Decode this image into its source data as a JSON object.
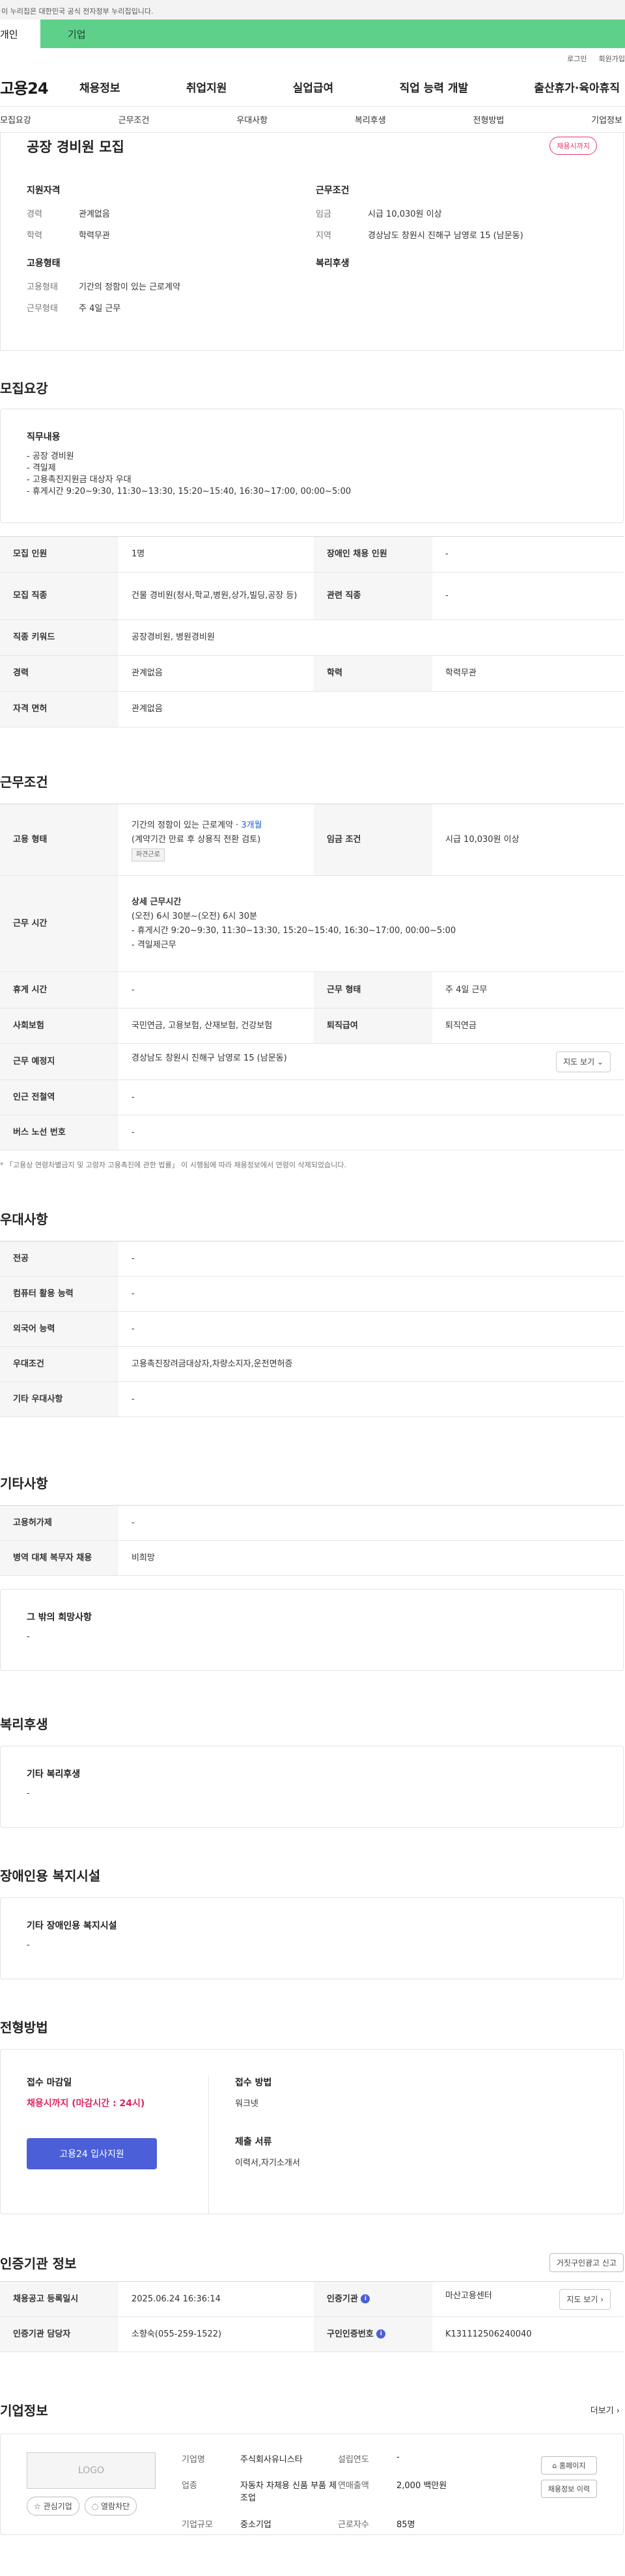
{
  "banner": {
    "text": "이 누리집은 대한민국 공식 전자정부 누리집입니다."
  },
  "user_tabs": {
    "personal": "개인",
    "company": "기업"
  },
  "util_links": [
    "로그인",
    "회원가입"
  ],
  "logo": "고용24",
  "gnb": [
    "채용정보",
    "취업지원",
    "실업급여",
    "직업 능력 개발",
    "출산휴가·육아휴직"
  ],
  "anchor_nav": [
    "모집요강",
    "근무조건",
    "우대사항",
    "복리후생",
    "전형방법",
    "기업정보"
  ],
  "summary": {
    "title": "공장 경비원 모집",
    "badge": "채용시까지",
    "qualification_title": "지원자격",
    "career_label": "경력",
    "career_value": "관계없음",
    "education_label": "학력",
    "education_value": "학력무관",
    "employment_title": "고용형태",
    "emp_type_label": "고용형태",
    "emp_type_value": "기간의 정함이 있는 근로계약",
    "work_form_label": "근무형태",
    "work_form_value": "주 4일 근무",
    "conditions_title": "근무조건",
    "wage_label": "임금",
    "wage_value": "시급 10,030원 이상",
    "region_label": "지역",
    "region_value": "경상남도 창원시 진해구 남영로 15 (남문동)",
    "welfare_title": "복리후생"
  },
  "recruit": {
    "section_title": "모집요강",
    "duty_title": "직무내용",
    "duty_lines": [
      "- 공장 경비원",
      "- 격일제",
      "- 고용촉진지원금 대상자 우대",
      "- 휴게시간 9:20~9:30, 11:30~13:30, 15:20~15:40, 16:30~17:00, 00:00~5:00"
    ],
    "rows": {
      "headcount_h": "모집 인원",
      "headcount_v": "1명",
      "disabled_h": "장애인 채용 인원",
      "disabled_v": "-",
      "job_h": "모집 직종",
      "job_v": "건물 경비원(청사,학교,병원,상가,빌딩,공장 등)",
      "related_h": "관련 직종",
      "related_v": "-",
      "keyword_h": "직종 키워드",
      "keyword_v": "공장경비원, 병원경비원",
      "career_h": "경력",
      "career_v": "관계없음",
      "edu_h": "학력",
      "edu_v": "학력무관",
      "license_h": "자격 면허",
      "license_v": "관계없음"
    }
  },
  "conditions": {
    "section_title": "근무조건",
    "emp_h": "고용 형태",
    "emp_v1": "기간의 정함이 있는 근로계약 · ",
    "emp_v1_period": "3개월",
    "emp_v2": "(계약기간 만료 후 상용직 전환 검토)",
    "emp_tag": "파견근로",
    "wage_h": "임금 조건",
    "wage_v": "시급 10,030원 이상",
    "time_h": "근무 시간",
    "time_lines": [
      "상세 근무시간",
      "(오전) 6시 30분~(오전) 6시 30분",
      "- 휴게시간 9:20~9:30, 11:30~13:30, 15:20~15:40, 16:30~17:00, 00:00~5:00",
      "- 격일제근무"
    ],
    "break_h": "휴게 시간",
    "break_v": "-",
    "form_h": "근무 형태",
    "form_v": "주 4일 근무",
    "insurance_h": "사회보험",
    "insurance_v": "국민연금, 고용보험, 산재보험, 건강보험",
    "retire_h": "퇴직급여",
    "retire_v": "퇴직연금",
    "place_h": "근무 예정지",
    "place_v": "경상남도 창원시 진해구 남영로 15 (남문동)",
    "map_btn": "지도 보기 ⌄",
    "station_h": "인근 전철역",
    "station_v": "-",
    "bus_h": "버스 노선 번호",
    "bus_v": "-",
    "footnote": "* 「고용상 연령차별금지 및 고령자 고용촉진에 관한 법률」 이 시행됨에 따라 채용정보에서 연령이 삭제되었습니다."
  },
  "preference": {
    "section_title": "우대사항",
    "major_h": "전공",
    "major_v": "-",
    "computer_h": "컴퓨터 활용 능력",
    "computer_v": "-",
    "lang_h": "외국어 능력",
    "lang_v": "-",
    "cond_h": "우대조건",
    "cond_v": "고용촉진장려금대상자,차량소지자,운전면허증",
    "etc_h": "기타 우대사항",
    "etc_v": "-"
  },
  "other": {
    "section_title": "기타사항",
    "hire_h": "고용허가제",
    "hire_v": "-",
    "military_h": "병역 대체 복무자 채용",
    "military_v": "비희망",
    "wish_title": "그 밖의 희망사항",
    "wish_v": "-"
  },
  "welfare": {
    "section_title": "복리후생",
    "box_title": "기타 복리후생",
    "box_v": "-"
  },
  "disability": {
    "section_title": "장애인용 복지시설",
    "box_title": "기타 장애인용 복지시설",
    "box_v": "-"
  },
  "screening": {
    "section_title": "전형방법",
    "deadline_label": "접수 마감일",
    "deadline_v": "채용시까지 (마감시간 : 24시)",
    "apply_btn": "고용24 입사지원",
    "method_label": "접수 방법",
    "method_v": "워크넷",
    "docs_label": "제출 서류",
    "docs_v": "이력서,자기소개서"
  },
  "cert": {
    "section_title": "인증기관 정보",
    "report_btn": "거짓구인광고 신고",
    "reg_h": "채용공고 등록일시",
    "reg_v": "2025.06.24 16:36:14",
    "agency_h": "인증기관",
    "agency_v": "마산고용센터",
    "map_btn": "지도 보기 ›",
    "manager_h": "인증기관 담당자",
    "manager_v": "소향숙(055-259-1522)",
    "auth_h": "구인인증번호",
    "auth_v": "K131112506240040"
  },
  "company": {
    "section_title": "기업정보",
    "more": "더보기 ›",
    "logo_text": "LOGO",
    "interest_btn": "☆ 관심기업",
    "block_btn": "◌ 열람차단",
    "name_k": "기업명",
    "name_v": "주식회사유니스타",
    "year_k": "설립연도",
    "year_v": "-",
    "industry_k": "업종",
    "industry_v": "자동차 차체용 신품 부품 제조업",
    "sales_k": "연매출액",
    "sales_v": "2,000 백만원",
    "size_k": "기업규모",
    "size_v": "중소기업",
    "staff_k": "근로자수",
    "staff_v": "85명",
    "homepage_btn": "⌂ 홈페이지",
    "history_btn": "채용정보 이력"
  }
}
